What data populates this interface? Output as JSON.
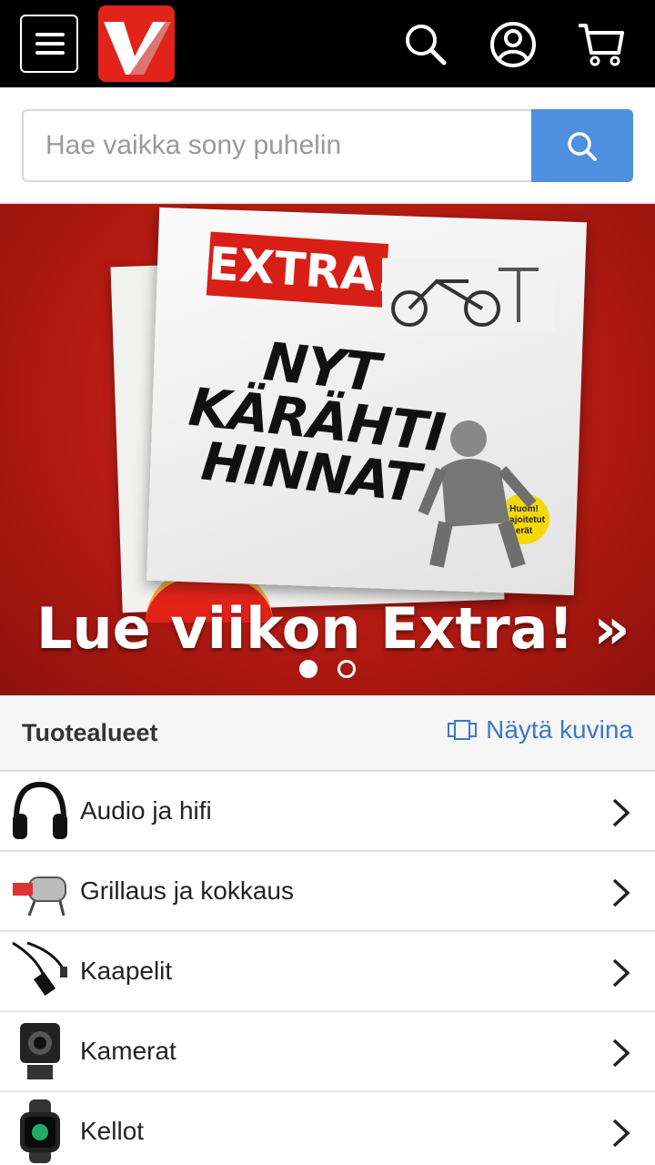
{
  "header": {
    "logo_letter": "V",
    "icons": [
      "menu-icon",
      "search-icon",
      "user-icon",
      "cart-icon"
    ]
  },
  "search": {
    "placeholder": "Hae vaikka sony puhelin",
    "value": ""
  },
  "banner": {
    "paper_logo": "EXTRA!",
    "headline": "NYT KÄRÄHTI HINNAT",
    "sticker": "Huom! Rajoitetut erät",
    "cta": "Lue viikon Extra! »",
    "slides": 2,
    "active_slide": 1
  },
  "categories": {
    "title": "Tuotealueet",
    "show_images_label": "Näytä kuvina",
    "items": [
      {
        "label": "Audio ja hifi",
        "icon": "headphones-icon"
      },
      {
        "label": "Grillaus ja kokkaus",
        "icon": "grill-icon"
      },
      {
        "label": "Kaapelit",
        "icon": "cable-icon"
      },
      {
        "label": "Kamerat",
        "icon": "action-camera-icon"
      },
      {
        "label": "Kellot",
        "icon": "smartwatch-icon"
      }
    ]
  },
  "colors": {
    "header_bg": "#000000",
    "logo_red": "#e2231a",
    "search_button": "#4f8fe0",
    "link_blue": "#3a78c9"
  }
}
